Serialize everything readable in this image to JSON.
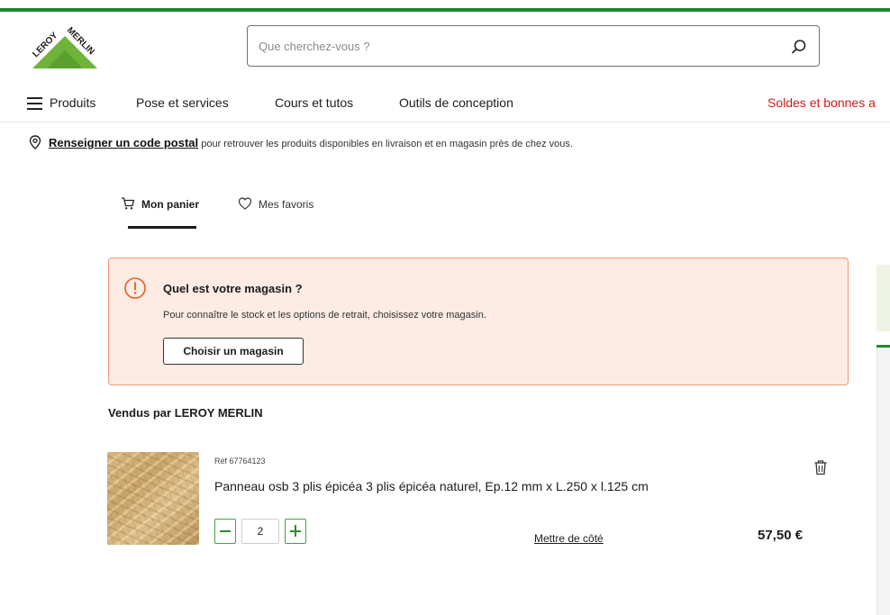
{
  "brand": {
    "name": "LEROY MERLIN",
    "color": "#1b8a2a",
    "logo_icon": "leroy-merlin-logo-icon"
  },
  "search": {
    "placeholder": "Que cherchez-vous ?",
    "value": "",
    "icon": "search-icon"
  },
  "nav": {
    "products_label": "Produits",
    "items": [
      "Pose et services",
      "Cours et tutos",
      "Outils de conception"
    ],
    "promo_label": "Soldes et bonnes a",
    "promo_color": "#d21818"
  },
  "postal": {
    "link_label": "Renseigner un code postal",
    "text": " pour retrouver les produits disponibles en livraison et en magasin près de chez vous."
  },
  "tabs": {
    "cart_label": "Mon panier",
    "favorites_label": "Mes favoris",
    "active": "Mon panier"
  },
  "store_alert": {
    "title": "Quel est votre magasin ?",
    "description": "Pour connaître le stock et les options de retrait, choisissez votre magasin.",
    "button_label": "Choisir un magasin",
    "bg_color": "#fdebe4",
    "border_color": "#ec9a75"
  },
  "cart": {
    "sold_by": "Vendus par LEROY MERLIN",
    "items": [
      {
        "ref": "Réf 67764123",
        "name": "Panneau osb 3 plis épicéa 3 plis épicéa naturel, Ep.12 mm x L.250 x l.125 cm",
        "quantity": "2",
        "set_aside_label": "Mettre de côté",
        "price": "57,50 €"
      }
    ]
  },
  "stepper_color": "#46a04a"
}
